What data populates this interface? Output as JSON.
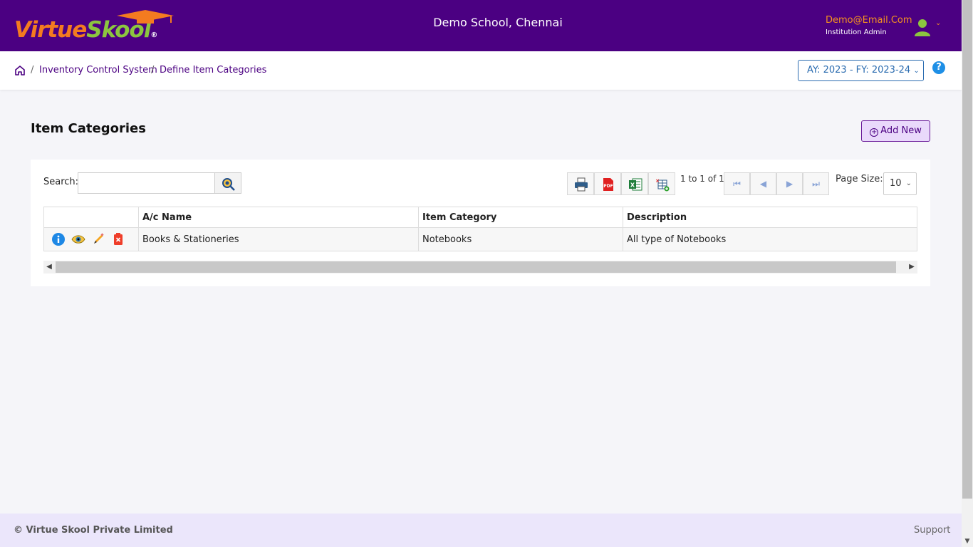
{
  "brand": {
    "logo_part1": "Virtue",
    "logo_part2": "Skool",
    "logo_reg": "®"
  },
  "header": {
    "school": "Demo School, Chennai",
    "user_email": "Demo@Email.Com",
    "user_role": "Institution Admin"
  },
  "breadcrumb": {
    "items": [
      "Inventory Control System",
      "Define Item Categories"
    ],
    "separator": "/"
  },
  "academic_year": {
    "label": "AY: 2023 - FY: 2023-24"
  },
  "help": {
    "label": "?"
  },
  "page": {
    "title": "Item Categories",
    "add_label": "Add New"
  },
  "search": {
    "label": "Search:",
    "value": "",
    "placeholder": ""
  },
  "toolbar": {
    "pager_info": "1 to 1 of 1",
    "page_size_label": "Page Size:",
    "page_size": "10"
  },
  "table": {
    "headers": [
      "",
      "A/c Name",
      "Item Category",
      "Description"
    ],
    "rows": [
      {
        "ac_name": "Books & Stationeries",
        "category": "Notebooks",
        "description": "All type of Notebooks"
      }
    ]
  },
  "footer": {
    "copyright": "© Virtue Skool Private Limited",
    "support": "Support"
  },
  "colors": {
    "header_bg": "#4b0082",
    "logo_orange": "#f47b20",
    "logo_green": "#8cc63f",
    "footer_bg": "#ebe6fb",
    "accent_blue": "#2b6cb0"
  }
}
